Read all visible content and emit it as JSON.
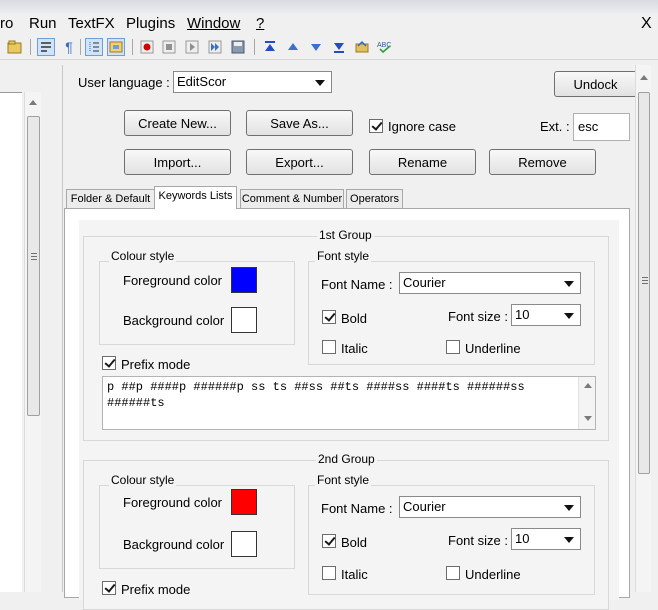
{
  "menu": {
    "items": [
      "ro",
      "Run",
      "TextFX",
      "Plugins",
      "Window",
      "?"
    ],
    "close": "X"
  },
  "toolbar": {
    "icons": [
      "open-folder-icon",
      "wrap-icon",
      "paragraph-icon",
      "indent-guide-icon",
      "doc-map-icon",
      "record-icon",
      "stop-icon",
      "play-icon",
      "play-multiple-icon",
      "save-macro-icon",
      "first-icon",
      "up-icon",
      "down-icon",
      "last-icon",
      "sync-icon",
      "spellcheck-icon"
    ]
  },
  "panel": {
    "user_language_label": "User language :",
    "user_language_value": "EditScor",
    "undock": "Undock",
    "create_new": "Create New...",
    "save_as": "Save As...",
    "ignore_case": "Ignore case",
    "ignore_case_checked": true,
    "ext_label": "Ext. :",
    "ext_value": "esc",
    "import": "Import...",
    "export": "Export...",
    "rename": "Rename",
    "remove": "Remove"
  },
  "tabs": [
    "Folder & Default",
    "Keywords Lists",
    "Comment & Number",
    "Operators"
  ],
  "active_tab": 1,
  "groups": [
    {
      "title": "1st Group",
      "colour_style": "Colour style",
      "fg_label": "Foreground color",
      "fg_color": "#0000ff",
      "bg_label": "Background color",
      "bg_color": "#ffffff",
      "font_style": "Font style",
      "font_name_label": "Font Name :",
      "font_name": "Courier",
      "bold": "Bold",
      "bold_checked": true,
      "font_size_label": "Font size :",
      "font_size": "10",
      "italic": "Italic",
      "underline": "Underline",
      "prefix_mode": "Prefix mode",
      "keywords_line1": "p ##p ####p ######p ss ts ##ss ##ts ####ss ####ts ######ss",
      "keywords_line2": "######ts"
    },
    {
      "title": "2nd Group",
      "colour_style": "Colour style",
      "fg_label": "Foreground color",
      "fg_color": "#ff0000",
      "bg_label": "Background color",
      "bg_color": "#ffffff",
      "font_style": "Font style",
      "font_name_label": "Font Name :",
      "font_name": "Courier",
      "bold": "Bold",
      "bold_checked": true,
      "font_size_label": "Font size :",
      "font_size": "10",
      "italic": "Italic",
      "underline": "Underline",
      "prefix_mode": "Prefix mode"
    }
  ]
}
